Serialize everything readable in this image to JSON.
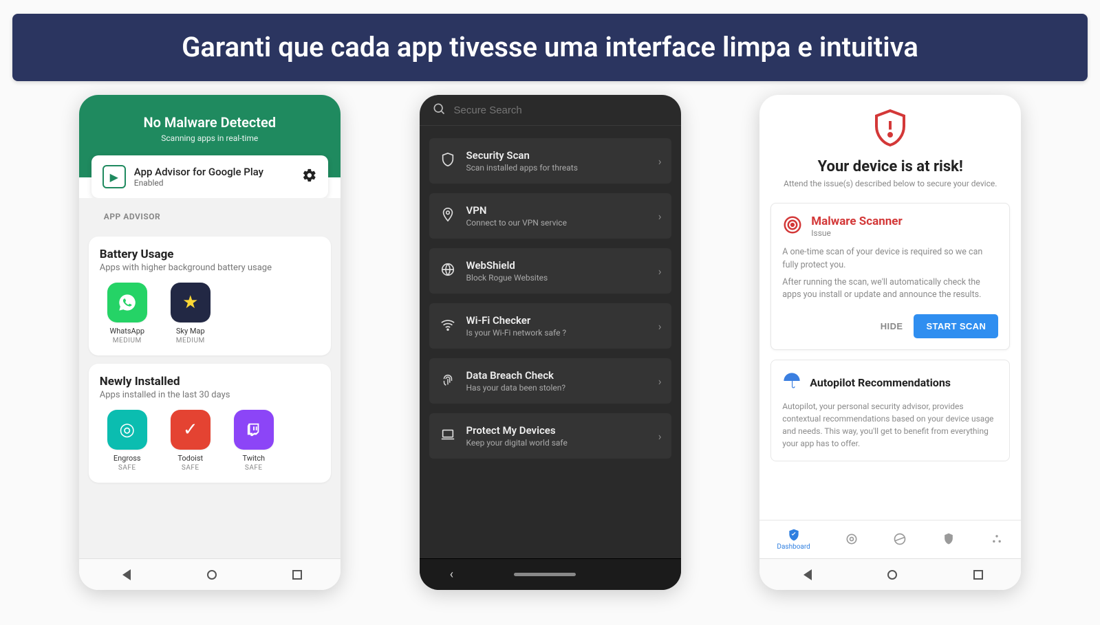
{
  "banner_text": "Garanti que cada app tivesse uma interface limpa e intuitiva",
  "phone1": {
    "header_title": "No Malware Detected",
    "header_sub": "Scanning apps in real-time",
    "advisor_title": "App Advisor for Google Play",
    "advisor_status": "Enabled",
    "section_label": "APP ADVISOR",
    "battery": {
      "title": "Battery Usage",
      "sub": "Apps with higher background battery usage",
      "tiles": [
        {
          "name": "WhatsApp",
          "status": "MEDIUM"
        },
        {
          "name": "Sky Map",
          "status": "MEDIUM"
        }
      ]
    },
    "newly": {
      "title": "Newly Installed",
      "sub": "Apps installed in the last 30 days",
      "tiles": [
        {
          "name": "Engross",
          "status": "SAFE"
        },
        {
          "name": "Todoist",
          "status": "SAFE"
        },
        {
          "name": "Twitch",
          "status": "SAFE"
        }
      ]
    }
  },
  "phone2": {
    "search_placeholder": "Secure Search",
    "items": [
      {
        "title": "Security Scan",
        "sub": "Scan installed apps for threats"
      },
      {
        "title": "VPN",
        "sub": "Connect to our VPN service"
      },
      {
        "title": "WebShield",
        "sub": "Block Rogue Websites"
      },
      {
        "title": "Wi-Fi Checker",
        "sub": "Is your Wi-Fi network safe ?"
      },
      {
        "title": "Data Breach Check",
        "sub": "Has your data been stolen?"
      },
      {
        "title": "Protect My Devices",
        "sub": "Keep your digital world safe"
      }
    ]
  },
  "phone3": {
    "risk_title": "Your device is at risk!",
    "risk_sub": "Attend the issue(s) described below to secure your device.",
    "malware": {
      "title": "Malware Scanner",
      "sub": "Issue",
      "body1": "A one-time scan of your device is required so we can fully protect you.",
      "body2": "After running the scan, we'll automatically check the apps you install or update and announce the results.",
      "hide": "HIDE",
      "start": "START SCAN"
    },
    "autopilot": {
      "title": "Autopilot Recommendations",
      "body": "Autopilot, your personal security advisor, provides contextual recommendations based on your device usage and needs. This way, you'll get to benefit from everything your app has to offer."
    },
    "tabs": {
      "dashboard": "Dashboard"
    }
  }
}
